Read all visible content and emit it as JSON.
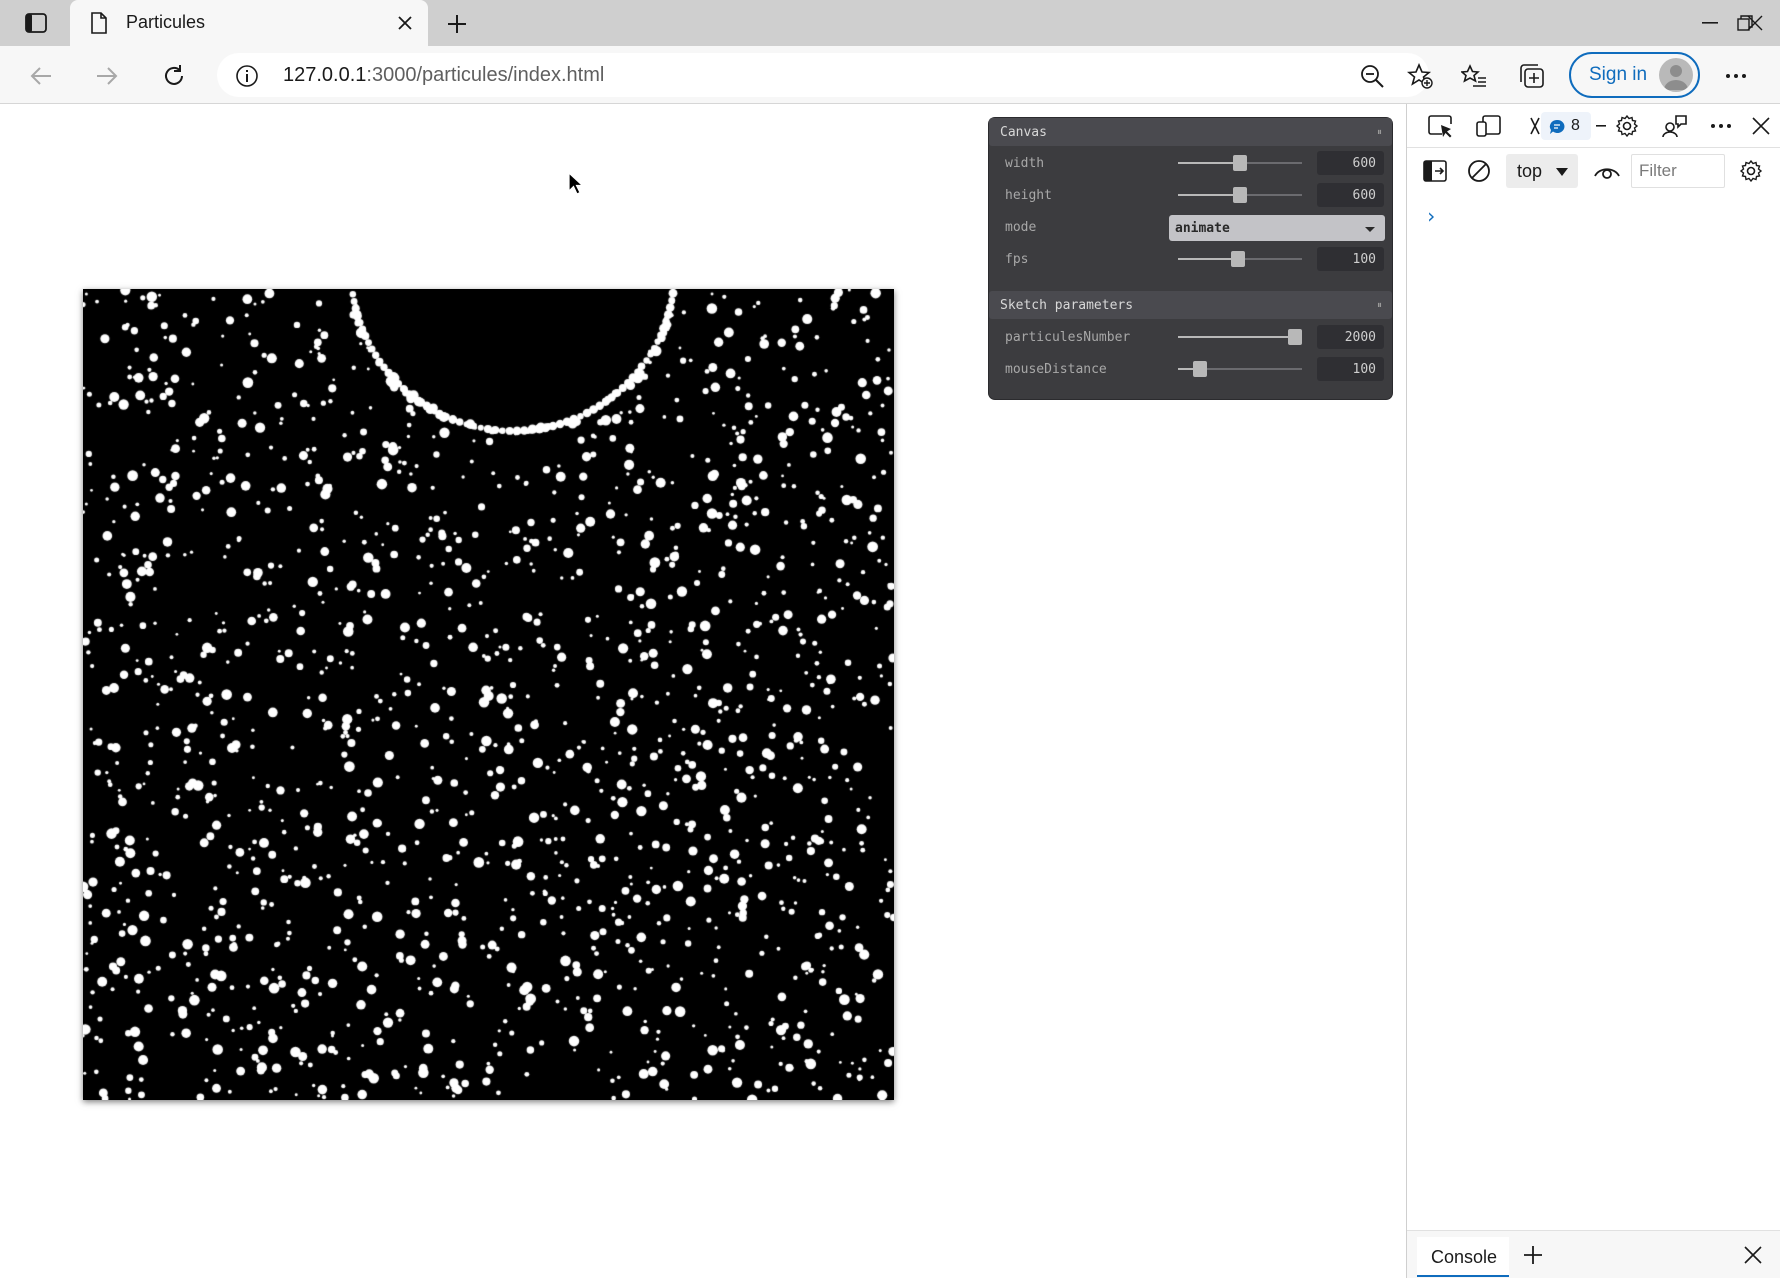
{
  "browser": {
    "tab_title": "Particules",
    "address_host": "127.0.0.1",
    "address_rest": ":3000/particules/index.html",
    "sign_in_label": "Sign in",
    "icons": [
      "sidebar-icon",
      "page-icon",
      "close-icon",
      "plus-icon",
      "minimize-icon",
      "restore-icon",
      "back-icon",
      "forward-icon",
      "refresh-icon",
      "info-icon",
      "zoom-out-icon",
      "add-favorite-icon",
      "favorites-icon",
      "collections-icon",
      "more-icon"
    ]
  },
  "gui": {
    "canvas": {
      "title": "Canvas",
      "width_label": "width",
      "width_value": "600",
      "width_fraction": 0.5,
      "height_label": "height",
      "height_value": "600",
      "height_fraction": 0.5,
      "mode_label": "mode",
      "mode_value": "animate",
      "fps_label": "fps",
      "fps_value": "100",
      "fps_fraction": 0.48
    },
    "sketch": {
      "title": "Sketch parameters",
      "particules_label": "particulesNumber",
      "particules_value": "2000",
      "particules_fraction": 0.99,
      "mouse_label": "mouseDistance",
      "mouse_value": "100",
      "mouse_fraction": 0.18
    }
  },
  "devtools": {
    "issues_count": "8",
    "context_value": "top",
    "filter_placeholder": "Filter",
    "prompt_glyph": "›",
    "console_tab_label": "Console"
  },
  "colors": {
    "accent": "#0f6cbd",
    "gui_bg": "#3c3c3f",
    "canvas_bg": "#000000",
    "particle": "#ffffff"
  }
}
